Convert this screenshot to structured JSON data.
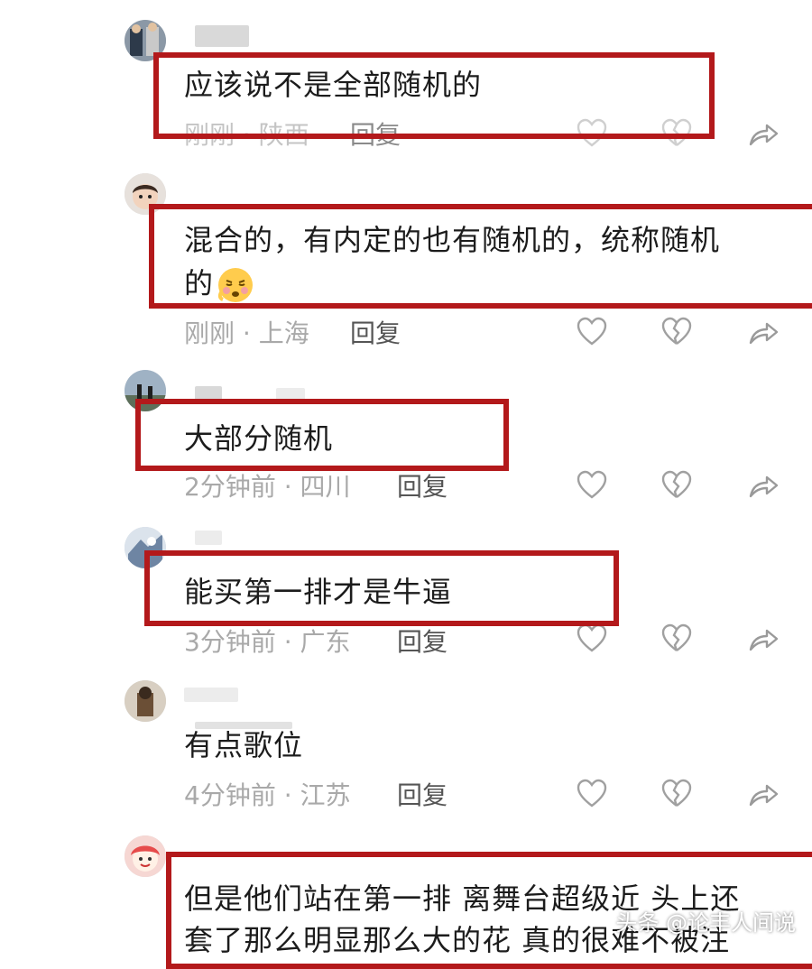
{
  "comments": [
    {
      "text": "应该说不是全部随机的",
      "time": "刚刚",
      "location": "陕西",
      "reply": "回复"
    },
    {
      "text_line1": "混合的，有内定的也有随机的，统称随机",
      "text_line2": "的",
      "time": "刚刚",
      "location": "上海",
      "reply": "回复"
    },
    {
      "text": "大部分随机",
      "time": "2分钟前",
      "location": "四川",
      "reply": "回复"
    },
    {
      "text": "能买第一排才是牛逼",
      "time": "3分钟前",
      "location": "广东",
      "reply": "回复"
    },
    {
      "text": "有点歌位",
      "time": "4分钟前",
      "location": "江苏",
      "reply": "回复"
    },
    {
      "text_line1": "但是他们站在第一排 离舞台超级近 头上还",
      "text_line2": "套了那么明显那么大的花 真的很难不被注"
    }
  ],
  "separator": "·",
  "icons": [
    "heart-icon",
    "broken-heart-icon",
    "share-icon"
  ],
  "watermark": "头条 @论丰人间说",
  "colors": {
    "highlight_box": "#b3191b",
    "meta_text": "#a9a9a9"
  }
}
